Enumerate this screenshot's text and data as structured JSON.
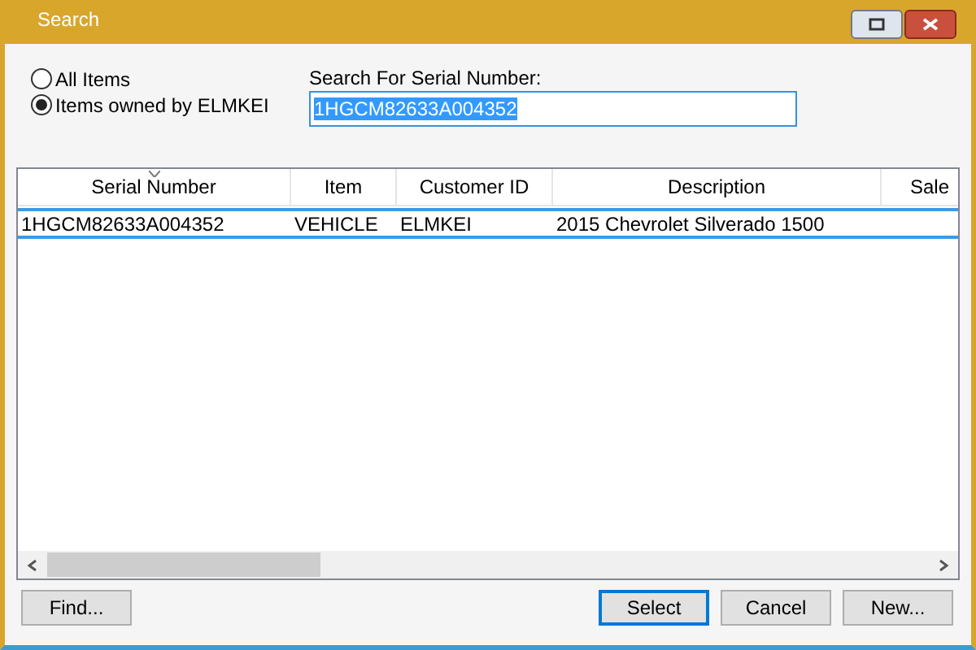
{
  "window": {
    "title": "Search"
  },
  "filter_options": [
    {
      "label": "All Items",
      "selected": false
    },
    {
      "label": "Items owned by ELMKEI",
      "selected": true
    }
  ],
  "search": {
    "label": "Search For Serial Number:",
    "value": "1HGCM82633A004352"
  },
  "table": {
    "columns": [
      {
        "label": "Serial Number",
        "sorted": true
      },
      {
        "label": "Item",
        "sorted": false
      },
      {
        "label": "Customer ID",
        "sorted": false
      },
      {
        "label": "Description",
        "sorted": false
      },
      {
        "label": "Sale",
        "sorted": false
      }
    ],
    "rows": [
      {
        "cells": [
          "1HGCM82633A004352",
          "VEHICLE",
          "ELMKEI",
          "2015 Chevrolet Silverado 1500"
        ],
        "selected": true
      }
    ]
  },
  "buttons": [
    {
      "label": "Find...",
      "default": false
    },
    {
      "label": "Select",
      "default": true
    },
    {
      "label": "Cancel",
      "default": false
    },
    {
      "label": "New...",
      "default": false
    }
  ]
}
